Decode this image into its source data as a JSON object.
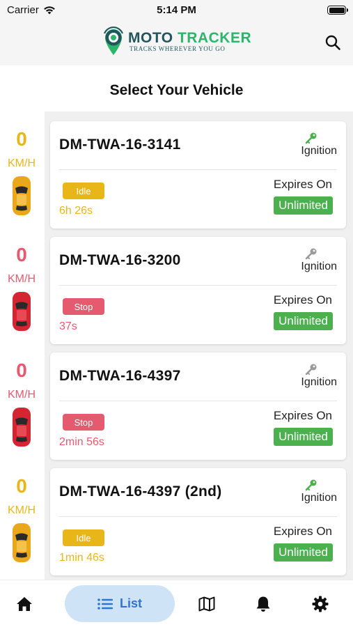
{
  "status_bar": {
    "carrier": "Carrier",
    "time": "5:14 PM"
  },
  "header": {
    "logo_word1": "MOTO",
    "logo_word2": "TRACKER",
    "logo_tagline": "TRACKS WHEREVER YOU GO",
    "search_icon": "search-icon"
  },
  "page_title": "Select Your Vehicle",
  "colors": {
    "idle": "#e9b619",
    "stop": "#e55a6e",
    "ignition_on": "#4cb04f",
    "ignition_off": "#9a9a9a",
    "unlimited_bg": "#4cb04f",
    "accent": "#2f74d0",
    "car_yellow": "#e9a81c",
    "car_red": "#d42632"
  },
  "vehicles": [
    {
      "speed": "0",
      "unit": "KM/H",
      "plate": "DM-TWA-16-3141",
      "ignition_label": "Ignition",
      "ignition_on": true,
      "status": "Idle",
      "duration": "6h 26s",
      "expires_label": "Expires On",
      "expires_value": "Unlimited"
    },
    {
      "speed": "0",
      "unit": "KM/H",
      "plate": "DM-TWA-16-3200",
      "ignition_label": "Ignition",
      "ignition_on": false,
      "status": "Stop",
      "duration": "37s",
      "expires_label": "Expires On",
      "expires_value": "Unlimited"
    },
    {
      "speed": "0",
      "unit": "KM/H",
      "plate": "DM-TWA-16-4397",
      "ignition_label": "Ignition",
      "ignition_on": false,
      "status": "Stop",
      "duration": "2min 56s",
      "expires_label": "Expires On",
      "expires_value": "Unlimited"
    },
    {
      "speed": "0",
      "unit": "KM/H",
      "plate": "DM-TWA-16-4397 (2nd)",
      "ignition_label": "Ignition",
      "ignition_on": true,
      "status": "Idle",
      "duration": "1min 46s",
      "expires_label": "Expires On",
      "expires_value": "Unlimited"
    }
  ],
  "tabbar": {
    "items": [
      {
        "icon": "home-icon"
      },
      {
        "icon": "list-icon",
        "label": "List",
        "active": true
      },
      {
        "icon": "map-icon"
      },
      {
        "icon": "bell-icon"
      },
      {
        "icon": "gear-icon"
      }
    ]
  }
}
